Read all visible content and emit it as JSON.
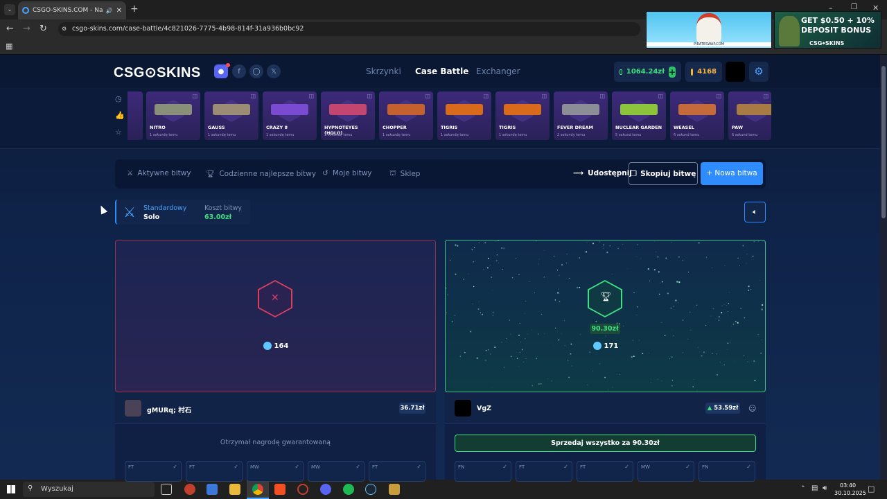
{
  "browser": {
    "tab_title": "CSGO-SKINS.COM - Najlep",
    "url": "csgo-skins.com/case-battle/4c821026-7775-4b98-814f-31a936b0bc92"
  },
  "ads": {
    "ad1_caption": "PIRATESWAP.COM",
    "ad2_line1": "GET $0.50 + 10%",
    "ad2_line2": "DEPOSIT BONUS",
    "ad2_brand": "CSG⌖SKINS"
  },
  "site": {
    "logo": "CSG⊙SKINS",
    "nav": [
      "Skrzynki",
      "Case Battle",
      "Exchanger"
    ],
    "balance": "1064.24zł",
    "coins": "4168"
  },
  "drops": [
    {
      "name": "NITRO",
      "time": "1 sekundę temu",
      "color": "#8a8f7a"
    },
    {
      "name": "GAUSS",
      "time": "1 sekundę temu",
      "color": "#9a8c75"
    },
    {
      "name": "CRAZY 8",
      "time": "1 sekundę temu",
      "color": "#7a4bd0"
    },
    {
      "name": "HYPNOTEYES (HOLO)",
      "time": "1 sekundę temu",
      "color": "#c2466f"
    },
    {
      "name": "CHOPPER",
      "time": "1 sekundę temu",
      "color": "#c5612e"
    },
    {
      "name": "TIGRIS",
      "time": "1 sekundę temu",
      "color": "#d86a1c"
    },
    {
      "name": "TIGRIS",
      "time": "1 sekundę temu",
      "color": "#d86a1c"
    },
    {
      "name": "FEVER DREAM",
      "time": "2 sekundy temu",
      "color": "#8d8d98"
    },
    {
      "name": "NUCLEAR GARDEN",
      "time": "5 sekund temu",
      "color": "#8cc43b"
    },
    {
      "name": "WEASEL",
      "time": "6 sekund temu",
      "color": "#c56a3b"
    },
    {
      "name": "PAW",
      "time": "6 sekund temu",
      "color": "#a87a44"
    }
  ],
  "battle_bar": {
    "active": "Aktywne bitwy",
    "daily": "Codzienne najlepsze bitwy",
    "mine": "Moje bitwy",
    "shop": "Sklep",
    "share": "Udostępnij",
    "copy": "Skopiuj bitwę",
    "new": "+ Nowa bitwa"
  },
  "info": {
    "mode_label": "Standardowy",
    "mode_value": "Solo",
    "cost_label": "Koszt bitwy",
    "cost_value": "63.00zł"
  },
  "left": {
    "points": "164",
    "player": "gMURq; 村石",
    "total": "36.71zł",
    "message": "Otrzymał nagrodę gwarantowaną",
    "cards": [
      "FT",
      "FT",
      "MW",
      "MW",
      "FT"
    ]
  },
  "right": {
    "prize": "90.30zł",
    "points": "171",
    "player": "VgZ",
    "total": "53.59zł",
    "sell": "Sprzedaj wszystko za 90.30zł",
    "cards": [
      "FN",
      "FT",
      "FT",
      "MW",
      "FN"
    ]
  },
  "taskbar": {
    "search": "Wyszukaj",
    "time": "03:40",
    "date": "30.10.2025"
  }
}
